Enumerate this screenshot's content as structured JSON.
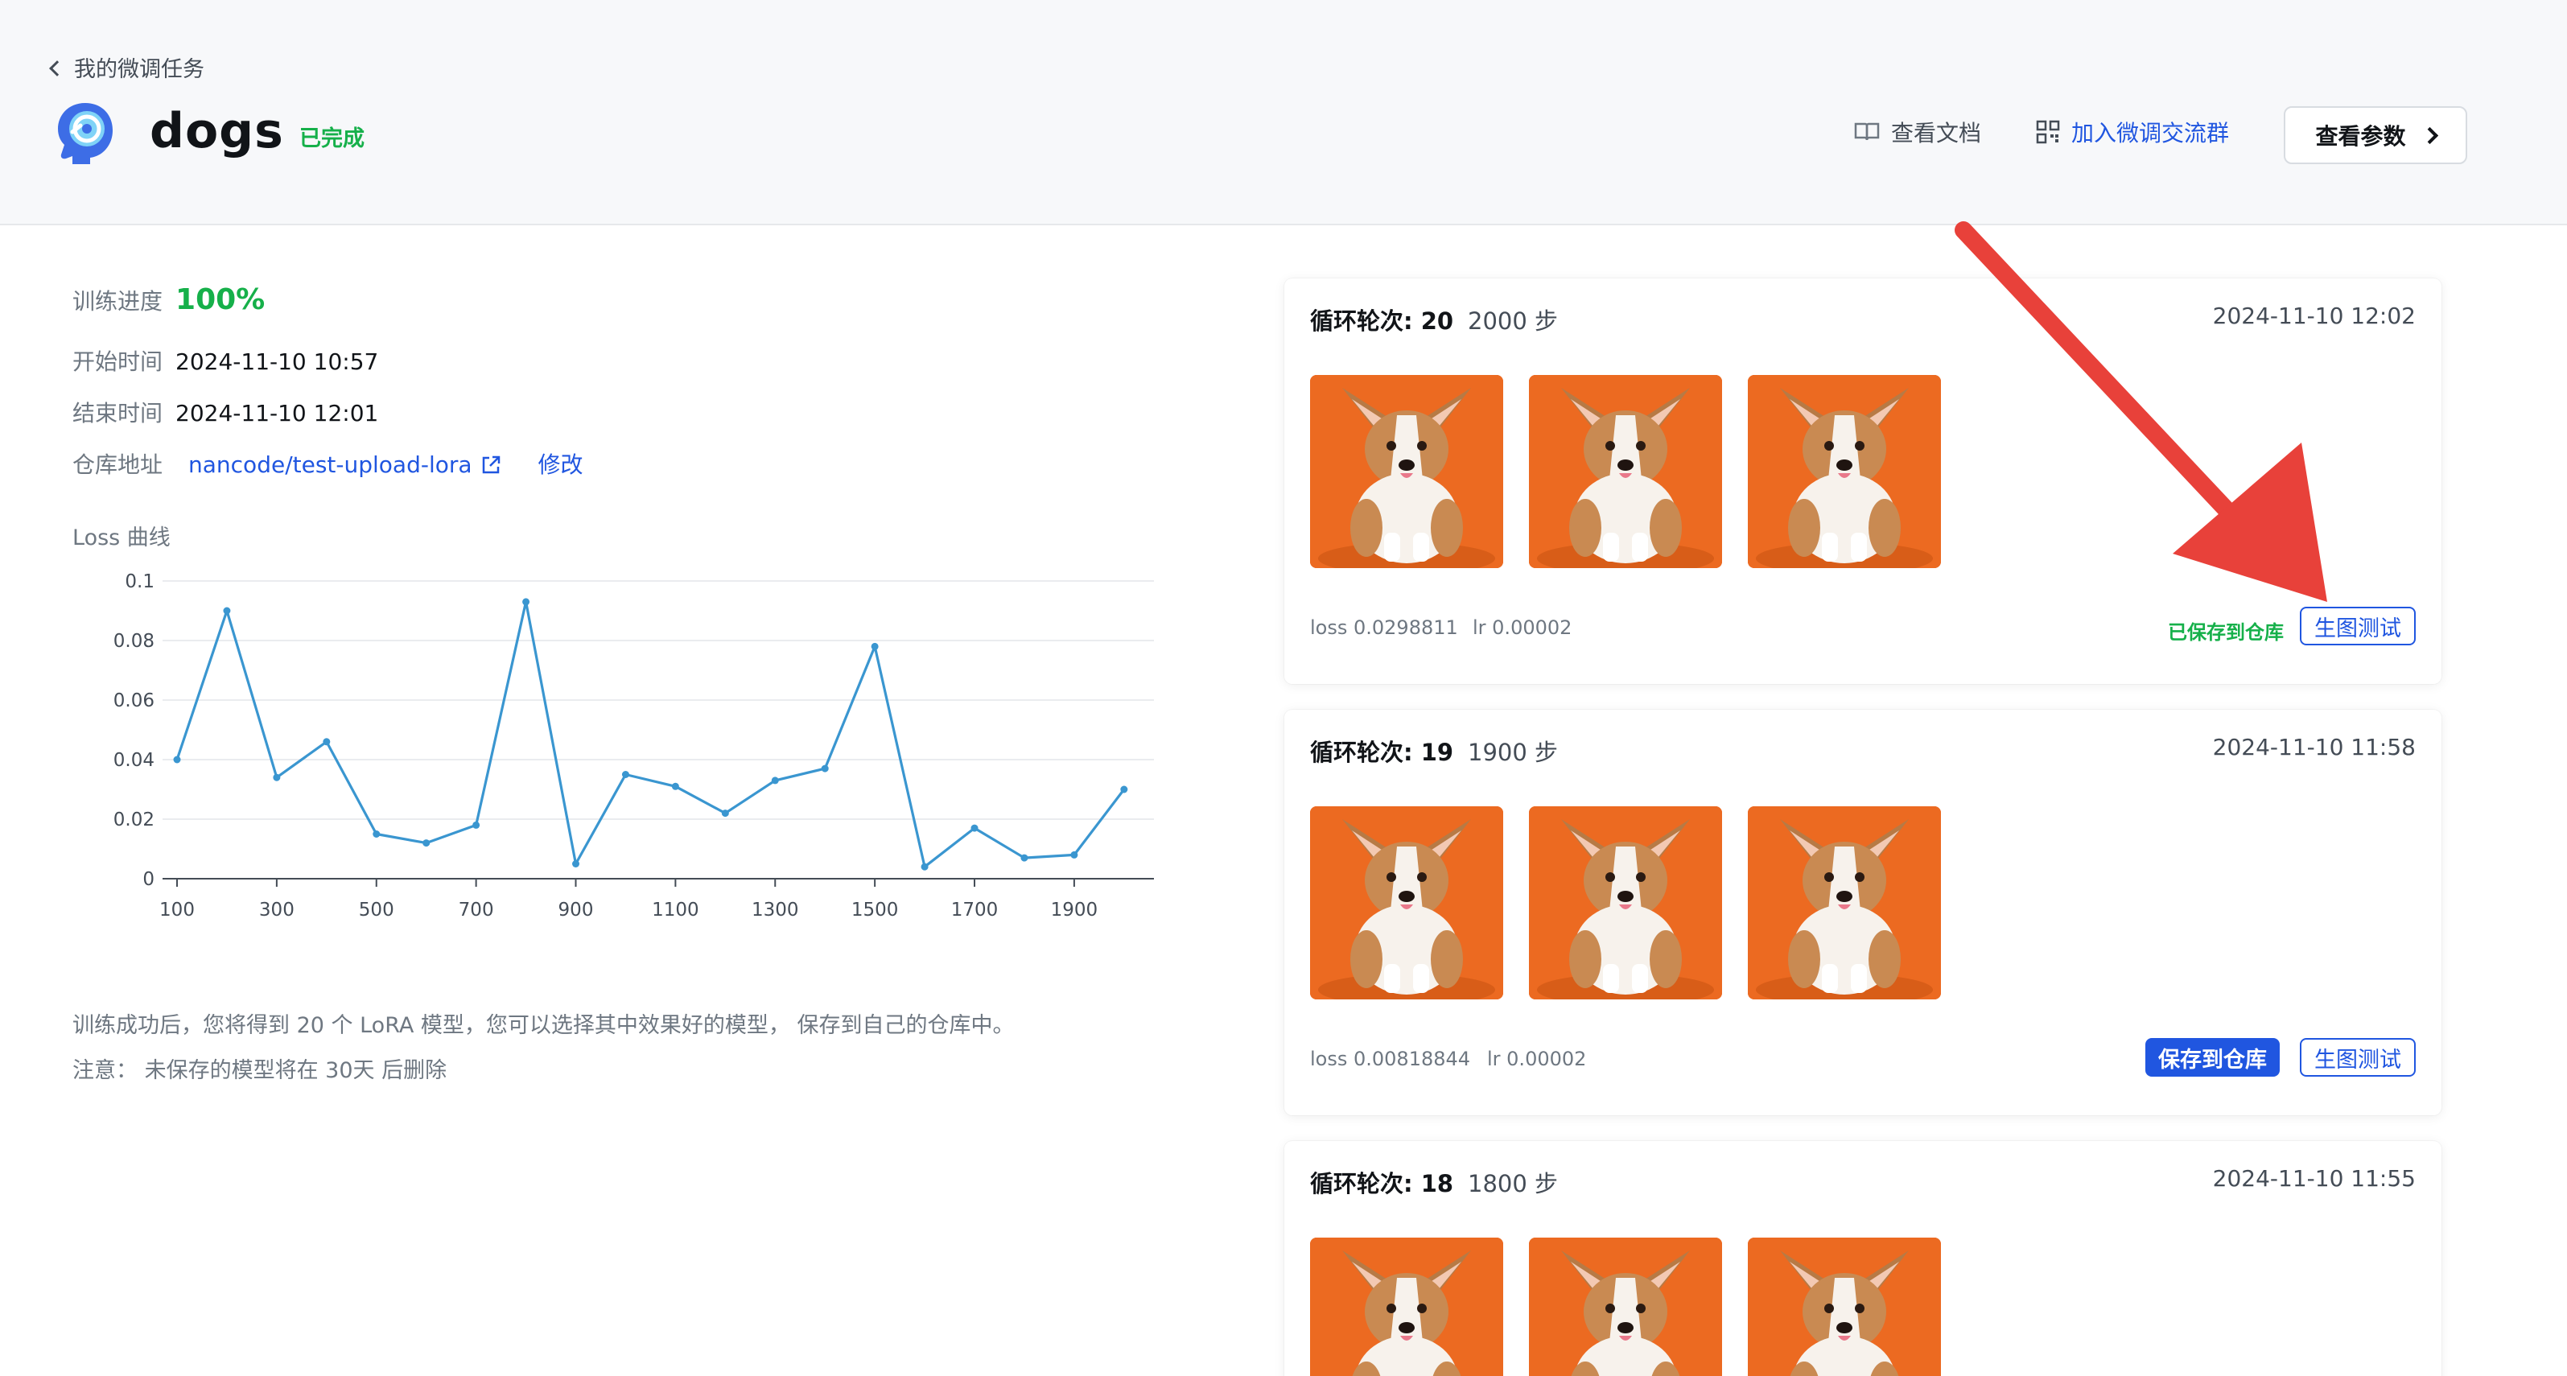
{
  "header": {
    "back_label": "我的微调任务",
    "title": "dogs",
    "status": "已完成",
    "docs_label": "查看文档",
    "group_label": "加入微调交流群",
    "params_label": "查看参数"
  },
  "info": {
    "progress_label": "训练进度",
    "progress_value": "100%",
    "start_label": "开始时间",
    "start_value": "2024-11-10 10:57",
    "end_label": "结束时间",
    "end_value": "2024-11-10 12:01",
    "repo_label": "仓库地址",
    "repo_value": "nancode/test-upload-lora",
    "edit_label": "修改"
  },
  "chart_data": {
    "type": "line",
    "title": "Loss 曲线",
    "x": [
      100,
      200,
      300,
      400,
      500,
      600,
      700,
      800,
      900,
      1000,
      1100,
      1200,
      1300,
      1400,
      1500,
      1600,
      1700,
      1800,
      1900,
      2000
    ],
    "values": [
      0.04,
      0.09,
      0.034,
      0.046,
      0.015,
      0.012,
      0.018,
      0.093,
      0.005,
      0.035,
      0.031,
      0.022,
      0.033,
      0.037,
      0.078,
      0.004,
      0.017,
      0.007,
      0.008,
      0.03
    ],
    "x_ticks": [
      "100",
      "300",
      "500",
      "700",
      "900",
      "1100",
      "1300",
      "1500",
      "1700",
      "1900"
    ],
    "y_ticks": [
      "0",
      "0.02",
      "0.04",
      "0.06",
      "0.08",
      "0.1"
    ],
    "ylim": [
      0,
      0.1
    ],
    "xlim": [
      100,
      2060
    ],
    "grid": true,
    "color": "#3a96d0"
  },
  "notes": {
    "line1": "训练成功后，您将得到 20 个 LoRA 模型，您可以选择其中效果好的模型， 保存到自己的仓库中。",
    "line2": "注意：  未保存的模型将在 30天 后删除"
  },
  "cards": [
    {
      "epoch": "循环轮次: 20",
      "steps": "2000 步",
      "time": "2024-11-10 12:02",
      "loss": "loss 0.0298811",
      "lr": "lr 0.00002",
      "saved": "已保存到仓库",
      "test": "生图测试"
    },
    {
      "epoch": "循环轮次: 19",
      "steps": "1900 步",
      "time": "2024-11-10 11:58",
      "loss": "loss 0.00818844",
      "lr": "lr 0.00002",
      "save": "保存到仓库",
      "test": "生图测试"
    },
    {
      "epoch": "循环轮次: 18",
      "steps": "1800 步",
      "time": "2024-11-10 11:55"
    }
  ],
  "colors": {
    "accent": "#2056e0",
    "success": "#16b04a",
    "annotation": "#e8413a",
    "thumb_bg": "#ec6a21"
  }
}
